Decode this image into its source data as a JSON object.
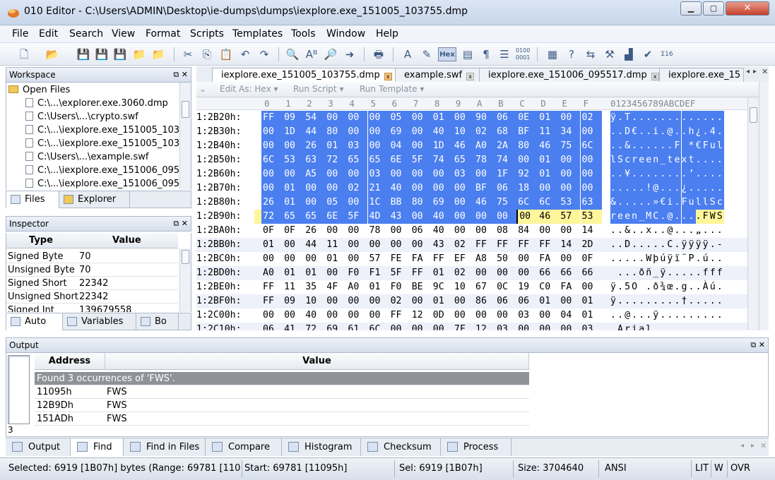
{
  "window": {
    "title": "010 Editor - C:\\Users\\ADMIN\\Desktop\\ie-dumps\\dumps\\iexplore.exe_151005_103755.dmp"
  },
  "menu": [
    "File",
    "Edit",
    "Search",
    "View",
    "Format",
    "Scripts",
    "Templates",
    "Tools",
    "Window",
    "Help"
  ],
  "toolbar": {
    "hex_label": "Hex"
  },
  "workspace": {
    "title": "Workspace",
    "group_label": "Open Files",
    "files": [
      "C:\\...\\explorer.exe.3060.dmp",
      "C:\\Users\\...\\crypto.swf",
      "C:\\...\\iexplore.exe_151005_103",
      "C:\\...\\iexplore.exe_151005_103",
      "C:\\Users\\...\\example.swf",
      "C:\\...\\iexplore.exe_151006_095",
      "C:\\...\\iexplore.exe_151006_095"
    ],
    "tabs": [
      "Files",
      "Explorer"
    ]
  },
  "inspector": {
    "title": "Inspector",
    "col_type": "Type",
    "col_value": "Value",
    "rows": [
      {
        "type": "Signed Byte",
        "value": "70"
      },
      {
        "type": "Unsigned Byte",
        "value": "70"
      },
      {
        "type": "Signed Short",
        "value": "22342"
      },
      {
        "type": "Unsigned Short",
        "value": "22342"
      },
      {
        "type": "Signed Int",
        "value": "139679558"
      }
    ],
    "tabs": [
      "Auto",
      "Variables",
      "Bo"
    ]
  },
  "documents": {
    "tabs": [
      "iexplore.exe_151005_103755.dmp",
      "example.swf",
      "iexplore.exe_151006_095517.dmp",
      "iexplore.exe_15"
    ],
    "edit_as": "Edit As: Hex",
    "run_script": "Run Script",
    "run_template": "Run Template"
  },
  "hex": {
    "col_header": "0   1   2   3   4   5   6   7   8   9   A   B   C   D   E   F",
    "ascii_header": "0123456789ABCDEF",
    "rows": [
      {
        "addr": "1:2B20h:",
        "bytes": "FF 09 54 00 00 00 05 00 01 00 90 06 0E 01 00 02",
        "ascii": "ÿ.T............."
      },
      {
        "addr": "1:2B30h:",
        "bytes": "00 1D 44 80 00 00 69 00 40 10 02 68 BF 11 34 00",
        "ascii": "..D€..i.@..h¿.4."
      },
      {
        "addr": "1:2B40h:",
        "bytes": "00 00 26 01 03 00 04 00 1D 46 A0 2A 80 46 75 6C",
        "ascii": "..&......F *€Ful"
      },
      {
        "addr": "1:2B50h:",
        "bytes": "6C 53 63 72 65 65 6E 5F 74 65 78 74 00 01 00 00",
        "ascii": "lScreen_text...."
      },
      {
        "addr": "1:2B60h:",
        "bytes": "00 00 A5 00 00 03 00 00 00 03 00 1F 92 01 00 00",
        "ascii": "..¥........’...."
      },
      {
        "addr": "1:2B70h:",
        "bytes": "00 01 00 00 02 21 40 00 00 00 BF 06 18 00 00 00",
        "ascii": ".....!@...¿....."
      },
      {
        "addr": "1:2B80h:",
        "bytes": "26 01 00 05 00 1C BB 80 69 00 46 75 6C 6C 53 63",
        "ascii": "&.....»€i.FullSc"
      },
      {
        "addr": "1:2B90h:",
        "bytes": "72 65 65 6E 5F 4D 43 00 40 00 00 00 00 46 57 53",
        "ascii": "reen_MC.@....FWS"
      },
      {
        "addr": "1:2BA0h:",
        "bytes": "0F 0F 26 00 00 78 00 06 40 00 00 08 84 00 00 14",
        "ascii": "..&..x..@...„..."
      },
      {
        "addr": "1:2BB0h:",
        "bytes": "01 00 44 11 00 00 00 00 43 02 FF FF FF FF 14 2D",
        "ascii": "..D.....C.ÿÿÿÿ.-"
      },
      {
        "addr": "1:2BC0h:",
        "bytes": "00 00 00 01 00 57 FE FA FF EF A8 50 00 FA 00 0F",
        "ascii": ".....Wþúÿï¨P.ú.."
      },
      {
        "addr": "1:2BD0h:",
        "bytes": "A0 01 01 00 F0 F1 5F FF 01 02 00 00 00 66 66 66",
        "ascii": " ...ðñ_ÿ.....fff"
      },
      {
        "addr": "1:2BE0h:",
        "bytes": "FF 11 35 4F A0 01 F0 BE 9C 10 67 0C 19 C0 FA 00",
        "ascii": "ÿ.5O .ð¾œ.g..Àú."
      },
      {
        "addr": "1:2BF0h:",
        "bytes": "FF 09 10 00 00 00 02 00 01 00 86 06 06 01 00 01",
        "ascii": "ÿ.........†....."
      },
      {
        "addr": "1:2C00h:",
        "bytes": "00 00 40 00 00 00 FF 12 0D 00 00 00 03 00 04 01",
        "ascii": "..@...ÿ........."
      },
      {
        "addr": "1:2C10h:",
        "bytes": "06 41 72 69 61 6C 00 00 00 7F 12 03 00 00 00 03",
        "ascii": ".Arial..........."
      }
    ]
  },
  "output": {
    "title": "Output",
    "col_address": "Address",
    "col_value": "Value",
    "summary": "Found 3 occurrences of 'FWS'.",
    "results": [
      {
        "address": "11095h",
        "value": "FWS"
      },
      {
        "address": "12B9Dh",
        "value": "FWS"
      },
      {
        "address": "151ADh",
        "value": "FWS"
      }
    ],
    "count": "3",
    "tabs": [
      "Output",
      "Find",
      "Find in Files",
      "Compare",
      "Histogram",
      "Checksum",
      "Process"
    ]
  },
  "status": {
    "selected": "Selected: 6919 [1B07h] bytes (Range: 69781 [1109",
    "start": "Start: 69781 [11095h]",
    "sel": "Sel: 6919 [1B07h]",
    "size": "Size: 3704640",
    "encoding": "ANSI",
    "lit": "LIT",
    "w": "W",
    "ovr": "OVR"
  }
}
